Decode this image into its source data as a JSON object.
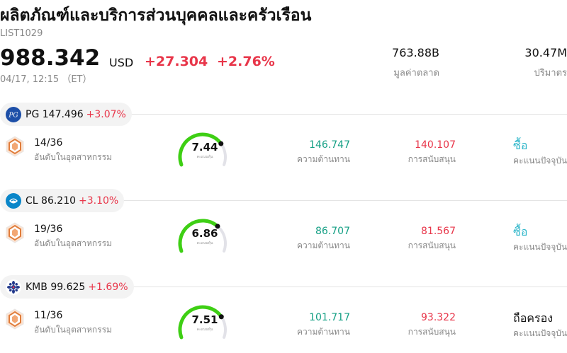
{
  "header": {
    "title": "ผลิตภัณฑ์และบริการส่วนบุคคลและครัวเรือน",
    "list_id": "LIST1029",
    "price": "988.342",
    "currency": "USD",
    "change": "+27.304",
    "change_pct": "+2.76%",
    "timestamp": "04/17, 12:15 （ET）",
    "market_cap_value": "763.88B",
    "market_cap_label": "มูลค่าตลาด",
    "volume_value": "30.47M",
    "volume_label": "ปริมาตร"
  },
  "colors": {
    "up": "#e8364a",
    "resistance": "#16a085",
    "buy": "#2bb5c9",
    "gauge_fill": "#3ecf14",
    "gauge_track": "#e2e2e8"
  },
  "stocks": [
    {
      "ticker": "PG",
      "price": "147.496",
      "change_pct": "+3.07%",
      "logo": "pg-logo",
      "rank": "14/36",
      "rank_label": "อันดับในอุตสาหกรรม",
      "score": "7.44",
      "score_fraction": 0.744,
      "score_label": "คะแนนหุ้น",
      "resistance": "146.747",
      "resistance_label": "ความต้านทาน",
      "support": "140.107",
      "support_label": "การสนับสนุน",
      "rating": "ซื้อ",
      "rating_color": "#2bb5c9",
      "rating_label": "คะแนนปัจจุบัน"
    },
    {
      "ticker": "CL",
      "price": "86.210",
      "change_pct": "+3.10%",
      "logo": "colgate-logo",
      "rank": "19/36",
      "rank_label": "อันดับในอุตสาหกรรม",
      "score": "6.86",
      "score_fraction": 0.686,
      "score_label": "คะแนนหุ้น",
      "resistance": "86.707",
      "resistance_label": "ความต้านทาน",
      "support": "81.567",
      "support_label": "การสนับสนุน",
      "rating": "ซื้อ",
      "rating_color": "#2bb5c9",
      "rating_label": "คะแนนปัจจุบัน"
    },
    {
      "ticker": "KMB",
      "price": "99.625",
      "change_pct": "+1.69%",
      "logo": "kimberly-clark-logo",
      "rank": "11/36",
      "rank_label": "อันดับในอุตสาหกรรม",
      "score": "7.51",
      "score_fraction": 0.751,
      "score_label": "คะแนนหุ้น",
      "resistance": "101.717",
      "resistance_label": "ความต้านทาน",
      "support": "93.322",
      "support_label": "การสนับสนุน",
      "rating": "ถือครอง",
      "rating_color": "#111111",
      "rating_label": "คะแนนปัจจุบัน"
    }
  ]
}
